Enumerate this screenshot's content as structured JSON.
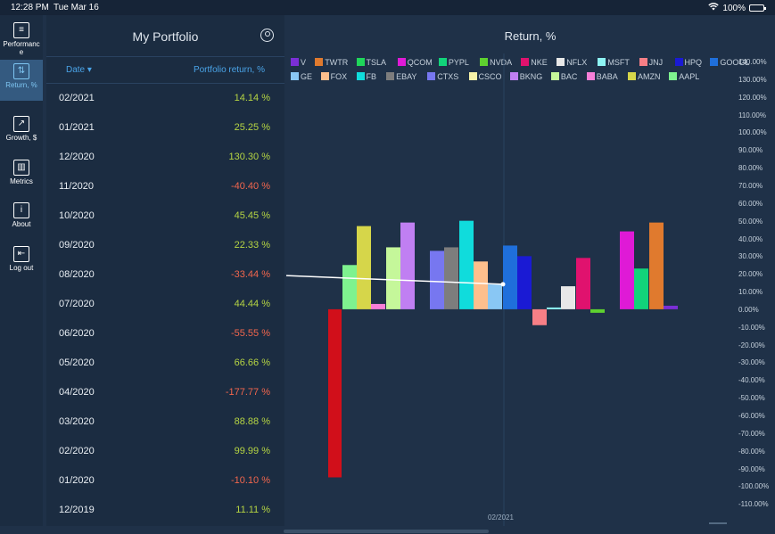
{
  "status": {
    "time": "12:28 PM",
    "date": "Tue Mar 16",
    "battery": "100%",
    "battery_level": 1.0
  },
  "nav": [
    {
      "label": "Performanc e",
      "icon": "portfolio-icon"
    },
    {
      "label": "Return, %",
      "icon": "return-chart-icon",
      "active": true
    },
    {
      "label": "Growth, $",
      "icon": "growth-chart-icon"
    },
    {
      "label": "Metrics",
      "icon": "metrics-icon"
    },
    {
      "label": "About",
      "icon": "info-icon"
    },
    {
      "label": "Log out",
      "icon": "logout-icon"
    }
  ],
  "panel": {
    "title": "My Portfolio",
    "col_date": "Date ▾",
    "col_return": "Portfolio return, %",
    "rows": [
      {
        "date": "02/2021",
        "value": "14.14 %",
        "neg": false
      },
      {
        "date": "01/2021",
        "value": "25.25 %",
        "neg": false
      },
      {
        "date": "12/2020",
        "value": "130.30 %",
        "neg": false
      },
      {
        "date": "11/2020",
        "value": "-40.40 %",
        "neg": true
      },
      {
        "date": "10/2020",
        "value": "45.45 %",
        "neg": false
      },
      {
        "date": "09/2020",
        "value": "22.33 %",
        "neg": false
      },
      {
        "date": "08/2020",
        "value": "-33.44 %",
        "neg": true
      },
      {
        "date": "07/2020",
        "value": "44.44 %",
        "neg": false
      },
      {
        "date": "06/2020",
        "value": "-55.55 %",
        "neg": true
      },
      {
        "date": "05/2020",
        "value": "66.66 %",
        "neg": false
      },
      {
        "date": "04/2020",
        "value": "-177.77 %",
        "neg": true
      },
      {
        "date": "03/2020",
        "value": "88.88 %",
        "neg": false
      },
      {
        "date": "02/2020",
        "value": "99.99 %",
        "neg": false
      },
      {
        "date": "01/2020",
        "value": "-10.10 %",
        "neg": true
      },
      {
        "date": "12/2019",
        "value": "11.11 %",
        "neg": false
      }
    ]
  },
  "chart_data": {
    "type": "bar",
    "title": "Return, %",
    "x_label": "02/2021",
    "ylim": [
      -110,
      140
    ],
    "y_ticks": [
      "140.00%",
      "130.00%",
      "120.00%",
      "110.00%",
      "100.00%",
      "90.00%",
      "80.00%",
      "70.00%",
      "60.00%",
      "50.00%",
      "40.00%",
      "30.00%",
      "20.00%",
      "10.00%",
      "0.00%",
      "-10.00%",
      "-20.00%",
      "-30.00%",
      "-40.00%",
      "-50.00%",
      "-60.00%",
      "-70.00%",
      "-80.00%",
      "-90.00%",
      "-100.00%",
      "-110.00%"
    ],
    "legend_position": "top",
    "series": [
      {
        "name": "V",
        "color": "#7b2fd6"
      },
      {
        "name": "TWTR",
        "color": "#e07a2e"
      },
      {
        "name": "TSLA",
        "color": "#1fd65a"
      },
      {
        "name": "QCOM",
        "color": "#df1ad6"
      },
      {
        "name": "PYPL",
        "color": "#12d47a"
      },
      {
        "name": "NVDA",
        "color": "#5ed12f"
      },
      {
        "name": "NKE",
        "color": "#e0126e"
      },
      {
        "name": "NFLX",
        "color": "#e8e8e8"
      },
      {
        "name": "MSFT",
        "color": "#8ef4f4"
      },
      {
        "name": "JNJ",
        "color": "#f77f86"
      },
      {
        "name": "HPQ",
        "color": "#1a1ad4"
      },
      {
        "name": "GOOGL",
        "color": "#1f6fdb"
      },
      {
        "name": "GE",
        "color": "#89c7f4"
      },
      {
        "name": "FOX",
        "color": "#fdbf8d"
      },
      {
        "name": "FB",
        "color": "#10dcdc"
      },
      {
        "name": "EBAY",
        "color": "#7d7d7d"
      },
      {
        "name": "CTXS",
        "color": "#7777f0"
      },
      {
        "name": "CSCO",
        "color": "#f7f3a8"
      },
      {
        "name": "BKNG",
        "color": "#c07ff2"
      },
      {
        "name": "BAC",
        "color": "#c5f79a"
      },
      {
        "name": "BABA",
        "color": "#f77fd8"
      },
      {
        "name": "AMZN",
        "color": "#d6d64a"
      },
      {
        "name": "AAPL",
        "color": "#7ef28f"
      }
    ],
    "bars": [
      {
        "series": "red",
        "color": "#d10f1a",
        "value": -95
      },
      {
        "series": "AAPL",
        "color": "#7ef28f",
        "value": 25
      },
      {
        "series": "AMZN",
        "color": "#d6d64a",
        "value": 47
      },
      {
        "series": "BABA",
        "color": "#f77fd8",
        "value": 3
      },
      {
        "series": "BAC",
        "color": "#c5f79a",
        "value": 35
      },
      {
        "series": "BKNG",
        "color": "#c07ff2",
        "value": 49
      },
      {
        "series": "CTXS",
        "color": "#7777f0",
        "value": 33
      },
      {
        "series": "EBAY",
        "color": "#7d7d7d",
        "value": 35
      },
      {
        "series": "FB",
        "color": "#10dcdc",
        "value": 50
      },
      {
        "series": "FOX",
        "color": "#fdbf8d",
        "value": 27
      },
      {
        "series": "GE",
        "color": "#89c7f4",
        "value": 14
      },
      {
        "series": "GOOGL",
        "color": "#1f6fdb",
        "value": 36
      },
      {
        "series": "HPQ",
        "color": "#1a1ad4",
        "value": 30
      },
      {
        "series": "JNJ",
        "color": "#f77f86",
        "value": -9
      },
      {
        "series": "MSFT",
        "color": "#8ef4f4",
        "value": 1
      },
      {
        "series": "NFLX",
        "color": "#e8e8e8",
        "value": 13
      },
      {
        "series": "NKE",
        "color": "#e0126e",
        "value": 29
      },
      {
        "series": "NVDA",
        "color": "#5ed12f",
        "value": -2
      },
      {
        "series": "QCOM",
        "color": "#df1ad6",
        "value": 44
      },
      {
        "series": "PYPL",
        "color": "#12d47a",
        "value": 23
      },
      {
        "series": "TWTR",
        "color": "#e07a2e",
        "value": 49
      },
      {
        "series": "V",
        "color": "#7b2fd6",
        "value": 2
      }
    ],
    "line": {
      "name": "Portfolio",
      "color": "#ffffff",
      "y_start": 19,
      "y_end": 14.14
    }
  }
}
